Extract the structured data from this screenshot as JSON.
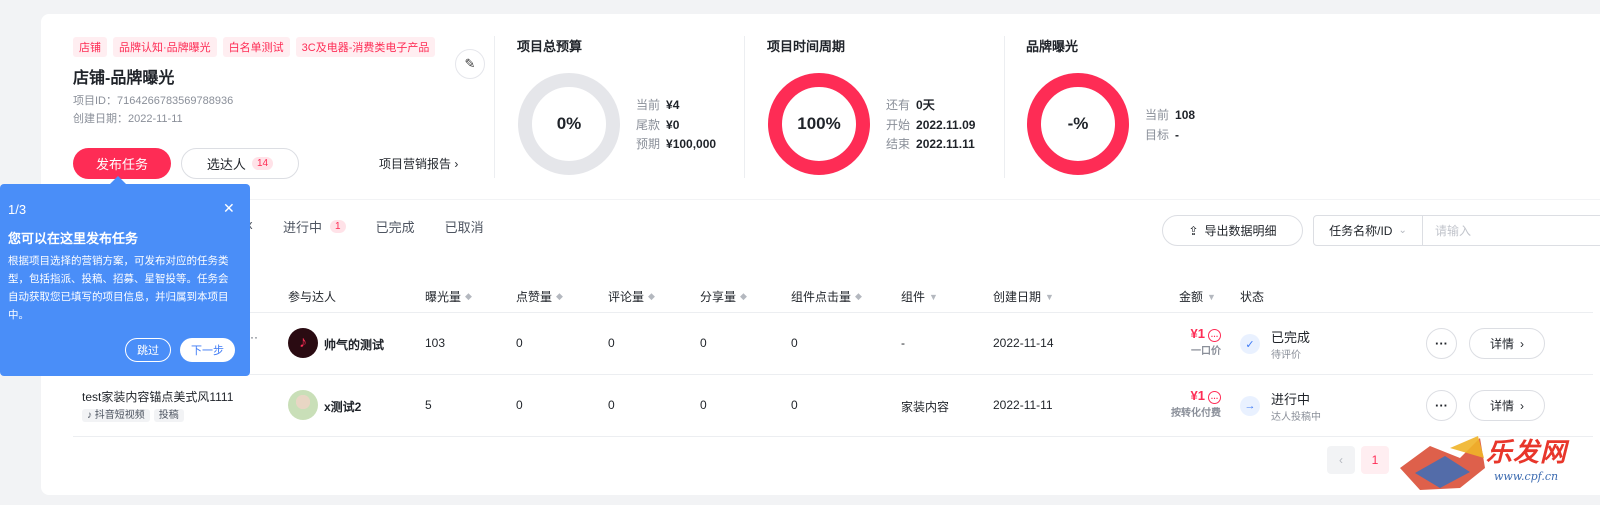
{
  "project": {
    "tags": [
      "店铺",
      "品牌认知·品牌曝光",
      "白名单测试",
      "3C及电器-消费类电子产品"
    ],
    "title": "店铺-品牌曝光",
    "id_line": "项目ID：7164266783569788936",
    "date_line": "创建日期：2022-11-11",
    "publish_label": "发布任务",
    "select_label": "选达人",
    "select_count": "14",
    "report_label": "项目营销报告",
    "report_arrow": "›"
  },
  "stats": {
    "budget": {
      "title": "项目总预算",
      "percent_text": "0%",
      "progress": 0,
      "lines": [
        {
          "label": "当前",
          "value": "¥4"
        },
        {
          "label": "尾款",
          "value": "¥0"
        },
        {
          "label": "预期",
          "value": "¥100,000"
        }
      ]
    },
    "period": {
      "title": "项目时间周期",
      "percent_text": "100%",
      "progress": 1,
      "lines": [
        {
          "label": "还有",
          "value": "0天"
        },
        {
          "label": "开始",
          "value": "2022.11.09"
        },
        {
          "label": "结束",
          "value": "2022.11.11"
        }
      ]
    },
    "exposure": {
      "title": "品牌曝光",
      "percent_text": "-%",
      "progress": 1,
      "lines": [
        {
          "label": "当前",
          "value": "108"
        },
        {
          "label": "目标",
          "value": "-"
        }
      ]
    }
  },
  "tabs": {
    "hidden_partial": "x",
    "items": [
      {
        "label": "进行中",
        "count": "1"
      },
      {
        "label": "已完成",
        "count": ""
      },
      {
        "label": "已取消",
        "count": ""
      }
    ]
  },
  "toolbar": {
    "export_label": "导出数据明细",
    "filter_label": "任务名称/ID",
    "search_placeholder": "请输入"
  },
  "table": {
    "headers": [
      "参与达人",
      "曝光量",
      "点赞量",
      "评论量",
      "分享量",
      "组件点击量",
      "组件",
      "创建日期",
      "金额",
      "状态"
    ],
    "rows": [
      {
        "task_partial": "··",
        "talent": "帅气的测试",
        "exposure": "103",
        "likes": "0",
        "comments": "0",
        "shares": "0",
        "clicks": "0",
        "component": "-",
        "date": "2022-11-14",
        "amount": "¥1",
        "amount_note": "一口价",
        "status": "已完成",
        "status_note": "待评价",
        "detail_label": "详情"
      },
      {
        "task": "test家装内容锚点美式风1111",
        "task_tags": [
          "抖音短视频",
          "投稿"
        ],
        "talent": "x测试2",
        "exposure": "5",
        "likes": "0",
        "comments": "0",
        "shares": "0",
        "clicks": "0",
        "component": "家装内容",
        "date": "2022-11-11",
        "amount": "¥1",
        "amount_note": "按转化付费",
        "status": "进行中",
        "status_note": "达人投稿中",
        "detail_label": "详情"
      }
    ]
  },
  "pagination": {
    "prev": "‹",
    "current": "1"
  },
  "guide": {
    "step": "1/3",
    "title": "您可以在这里发布任务",
    "body": "根据项目选择的营销方案，可发布对应的任务类型，包括指派、投稿、招募、星智投等。任务会自动获取您已填写的项目信息，并归属到本项目中。",
    "skip_label": "跳过",
    "next_label": "下一步"
  },
  "watermark": {
    "text": "乐发网",
    "url": "www.cpf.cn"
  },
  "colors": {
    "brand": "#fe2c55",
    "ring_empty": "#e5e6ea",
    "guide": "#4a8ef8"
  }
}
